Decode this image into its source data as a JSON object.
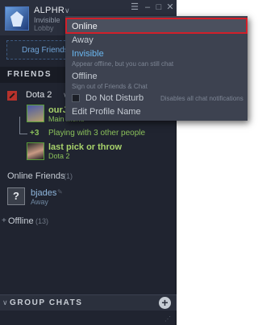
{
  "user": {
    "name": "ALPHR",
    "status": "Invisible",
    "substatus": "Lobby",
    "dropdown_icon": "chevron-down-icon"
  },
  "window_controls": {
    "menu": "☰",
    "minimize": "–",
    "maximize": "□",
    "close": "✕"
  },
  "drag_bar": {
    "text": "Drag Friends h"
  },
  "friends_section": {
    "header": "FRIENDS"
  },
  "game_group": {
    "title": "Dota 2",
    "icon": "dota-icon",
    "friends": [
      {
        "name": "ourJ",
        "status": "Main menu",
        "name_color": "#a8d36b"
      },
      {
        "name": "last pick or throw",
        "status": "Dota 2",
        "name_color": "#a8d36b"
      }
    ],
    "extra_count": "+3",
    "extra_text": "Playing with 3 other people"
  },
  "online_friends": {
    "header": "Online Friends",
    "count": "(1)",
    "items": [
      {
        "avatar": "?",
        "name": "bjades",
        "status": "Away"
      }
    ]
  },
  "offline": {
    "header": "Offline",
    "count": "(13)"
  },
  "group_chats": {
    "label": "GROUP CHATS"
  },
  "status_menu": {
    "online": "Online",
    "away": "Away",
    "invisible": "Invisible",
    "invisible_desc": "Appear offline, but you can still chat",
    "offline": "Offline",
    "offline_desc": "Sign out of Friends & Chat",
    "dnd": "Do Not Disturb",
    "dnd_desc": "Disables all chat notifications",
    "edit_profile": "Edit Profile Name",
    "highlight_color": "#d21f2a"
  },
  "colors": {
    "ingame": "#a8d36b",
    "invisible": "#6ab7f0",
    "away": "#8fb6dc"
  }
}
